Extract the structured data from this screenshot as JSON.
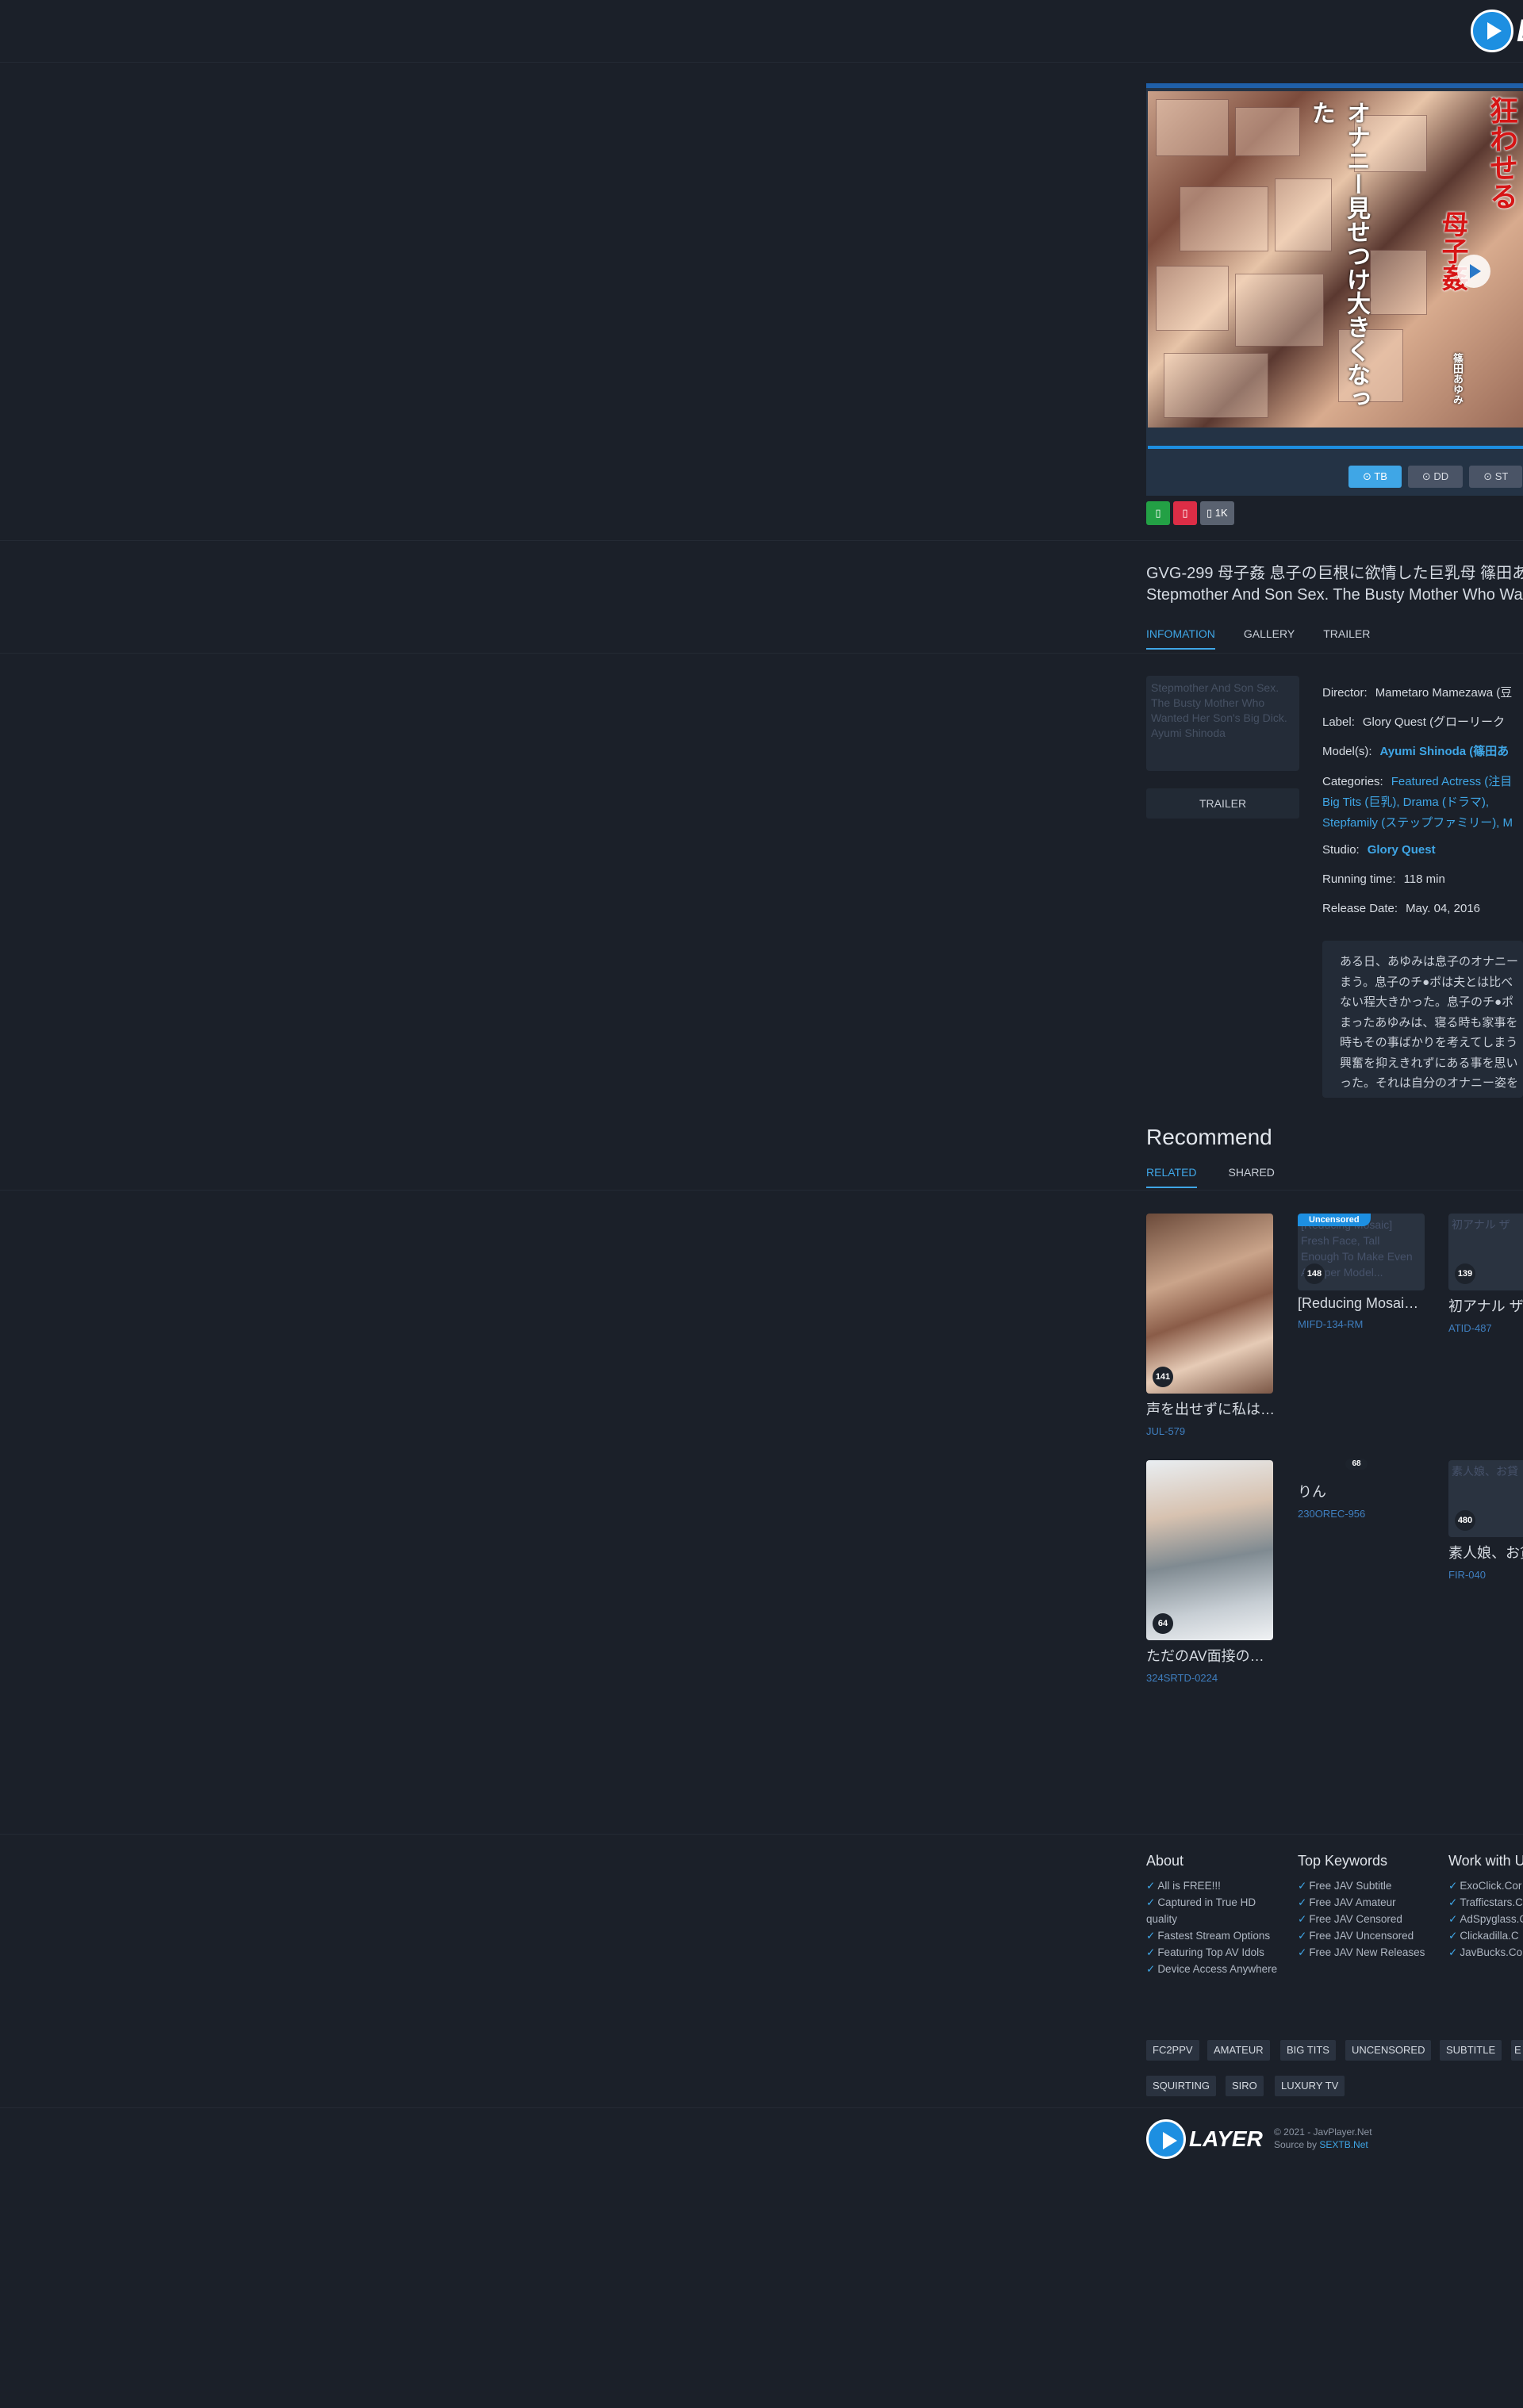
{
  "header": {
    "logo_text": "L"
  },
  "player": {
    "cover_text_red_1": "母子姦",
    "cover_text_red_2": "息子の巨根は母の理性を狂わせる",
    "cover_text_white_1": "オナニー見せつけ大きくなった",
    "cover_text_white_2": "篠田あゆみ",
    "servers": [
      "TB",
      "DD",
      "ST"
    ],
    "active_server": "TB"
  },
  "actions": {
    "like": "",
    "dislike": "",
    "views": "1K"
  },
  "video": {
    "title_line1": "GVG-299 母子姦 息子の巨根に欲情した巨乳母 篠田あ",
    "title_line2": "Stepmother And Son Sex. The Busty Mother Who Wa"
  },
  "tabs": [
    "INFOMATION",
    "GALLERY",
    "TRAILER"
  ],
  "thumbnail_alt": "Stepmother And Son Sex. The Busty Mother Who Wanted Her Son's Big Dick. Ayumi Shinoda",
  "trailer_button": "TRAILER",
  "info": {
    "director_label": "Director:",
    "director": "Mametaro Mamezawa (豆",
    "label_label": "Label:",
    "label": "Glory Quest (グローリーク",
    "models_label": "Model(s):",
    "models": "Ayumi Shinoda (篠田あ",
    "categories_label": "Categories:",
    "categories_line1": "Featured Actress (注目",
    "categories_line2": "Big Tits (巨乳), Drama (ドラマ),",
    "categories_line3": "Stepfamily (ステップファミリー), M",
    "studio_label": "Studio:",
    "studio": "Glory Quest",
    "running_label": "Running time:",
    "running": "118 min",
    "release_label": "Release Date:",
    "release": "May. 04, 2016"
  },
  "description": [
    "ある日、あゆみは息子のオナニー",
    "まう。息子のチ●ポは夫とは比べ",
    "ない程大きかった。息子のチ●ポ",
    "まったあゆみは、寝る時も家事を",
    "時もその事ばかりを考えてしまう",
    "興奮を抑えきれずにある事を思い",
    "った。それは自分のオナニー姿を"
  ],
  "recommend": {
    "title": "Recommend",
    "tabs": [
      "RELATED",
      "SHARED"
    ],
    "cards": [
      {
        "name": "声を出せずに私は…",
        "code": "JUL-579",
        "count": "141"
      },
      {
        "name": "[Reducing Mosai…",
        "code": "MIFD-134-RM",
        "count": "148",
        "badge": "Uncensored",
        "alt": "[Reducing Mosaic] Fresh Face, Tall Enough To Make Even A Super Model..."
      },
      {
        "name": "初アナル ザ",
        "code": "ATID-487",
        "count": "139",
        "alt": "初アナル ザ"
      },
      {
        "name": "ただのAV面接の…",
        "code": "324SRTD-0224",
        "count": "64"
      },
      {
        "name": "りん",
        "code": "230OREC-956",
        "count": "68"
      },
      {
        "name": "素人娘、お貸",
        "code": "FIR-040",
        "count": "480",
        "alt": "素人娘、お貸"
      }
    ]
  },
  "footer": {
    "about_title": "About",
    "about_items": [
      "All is FREE!!!",
      "Captured in True HD quality",
      "Fastest Stream Options",
      "Featuring Top AV Idols",
      "Device Access Anywhere"
    ],
    "keywords_title": "Top Keywords",
    "keywords_items": [
      "Free JAV Subtitle",
      "Free JAV Amateur",
      "Free JAV Censored",
      "Free JAV Uncensored",
      "Free JAV New Releases"
    ],
    "work_title": "Work with U",
    "work_items": [
      "ExoClick.Cor",
      "Trafficstars.C",
      "AdSpyglass.C",
      "Clickadilla.C",
      "JavBucks.Co"
    ],
    "tags_row1": [
      "FC2PPV",
      "AMATEUR",
      "BIG TITS",
      "UNCENSORED",
      "SUBTITLE",
      "E"
    ],
    "tags_row2": [
      "SQUIRTING",
      "SIRO",
      "LUXURY TV"
    ],
    "logo_text": "LAYER",
    "copyright": "© 2021 - JavPlayer.Net",
    "source_prefix": "Source by",
    "source_link": "SEXTB.Net"
  },
  "colors": {
    "background": "#1b2029",
    "accent": "#3fa6e6",
    "like": "#23a045",
    "dislike": "#dc2d46"
  }
}
